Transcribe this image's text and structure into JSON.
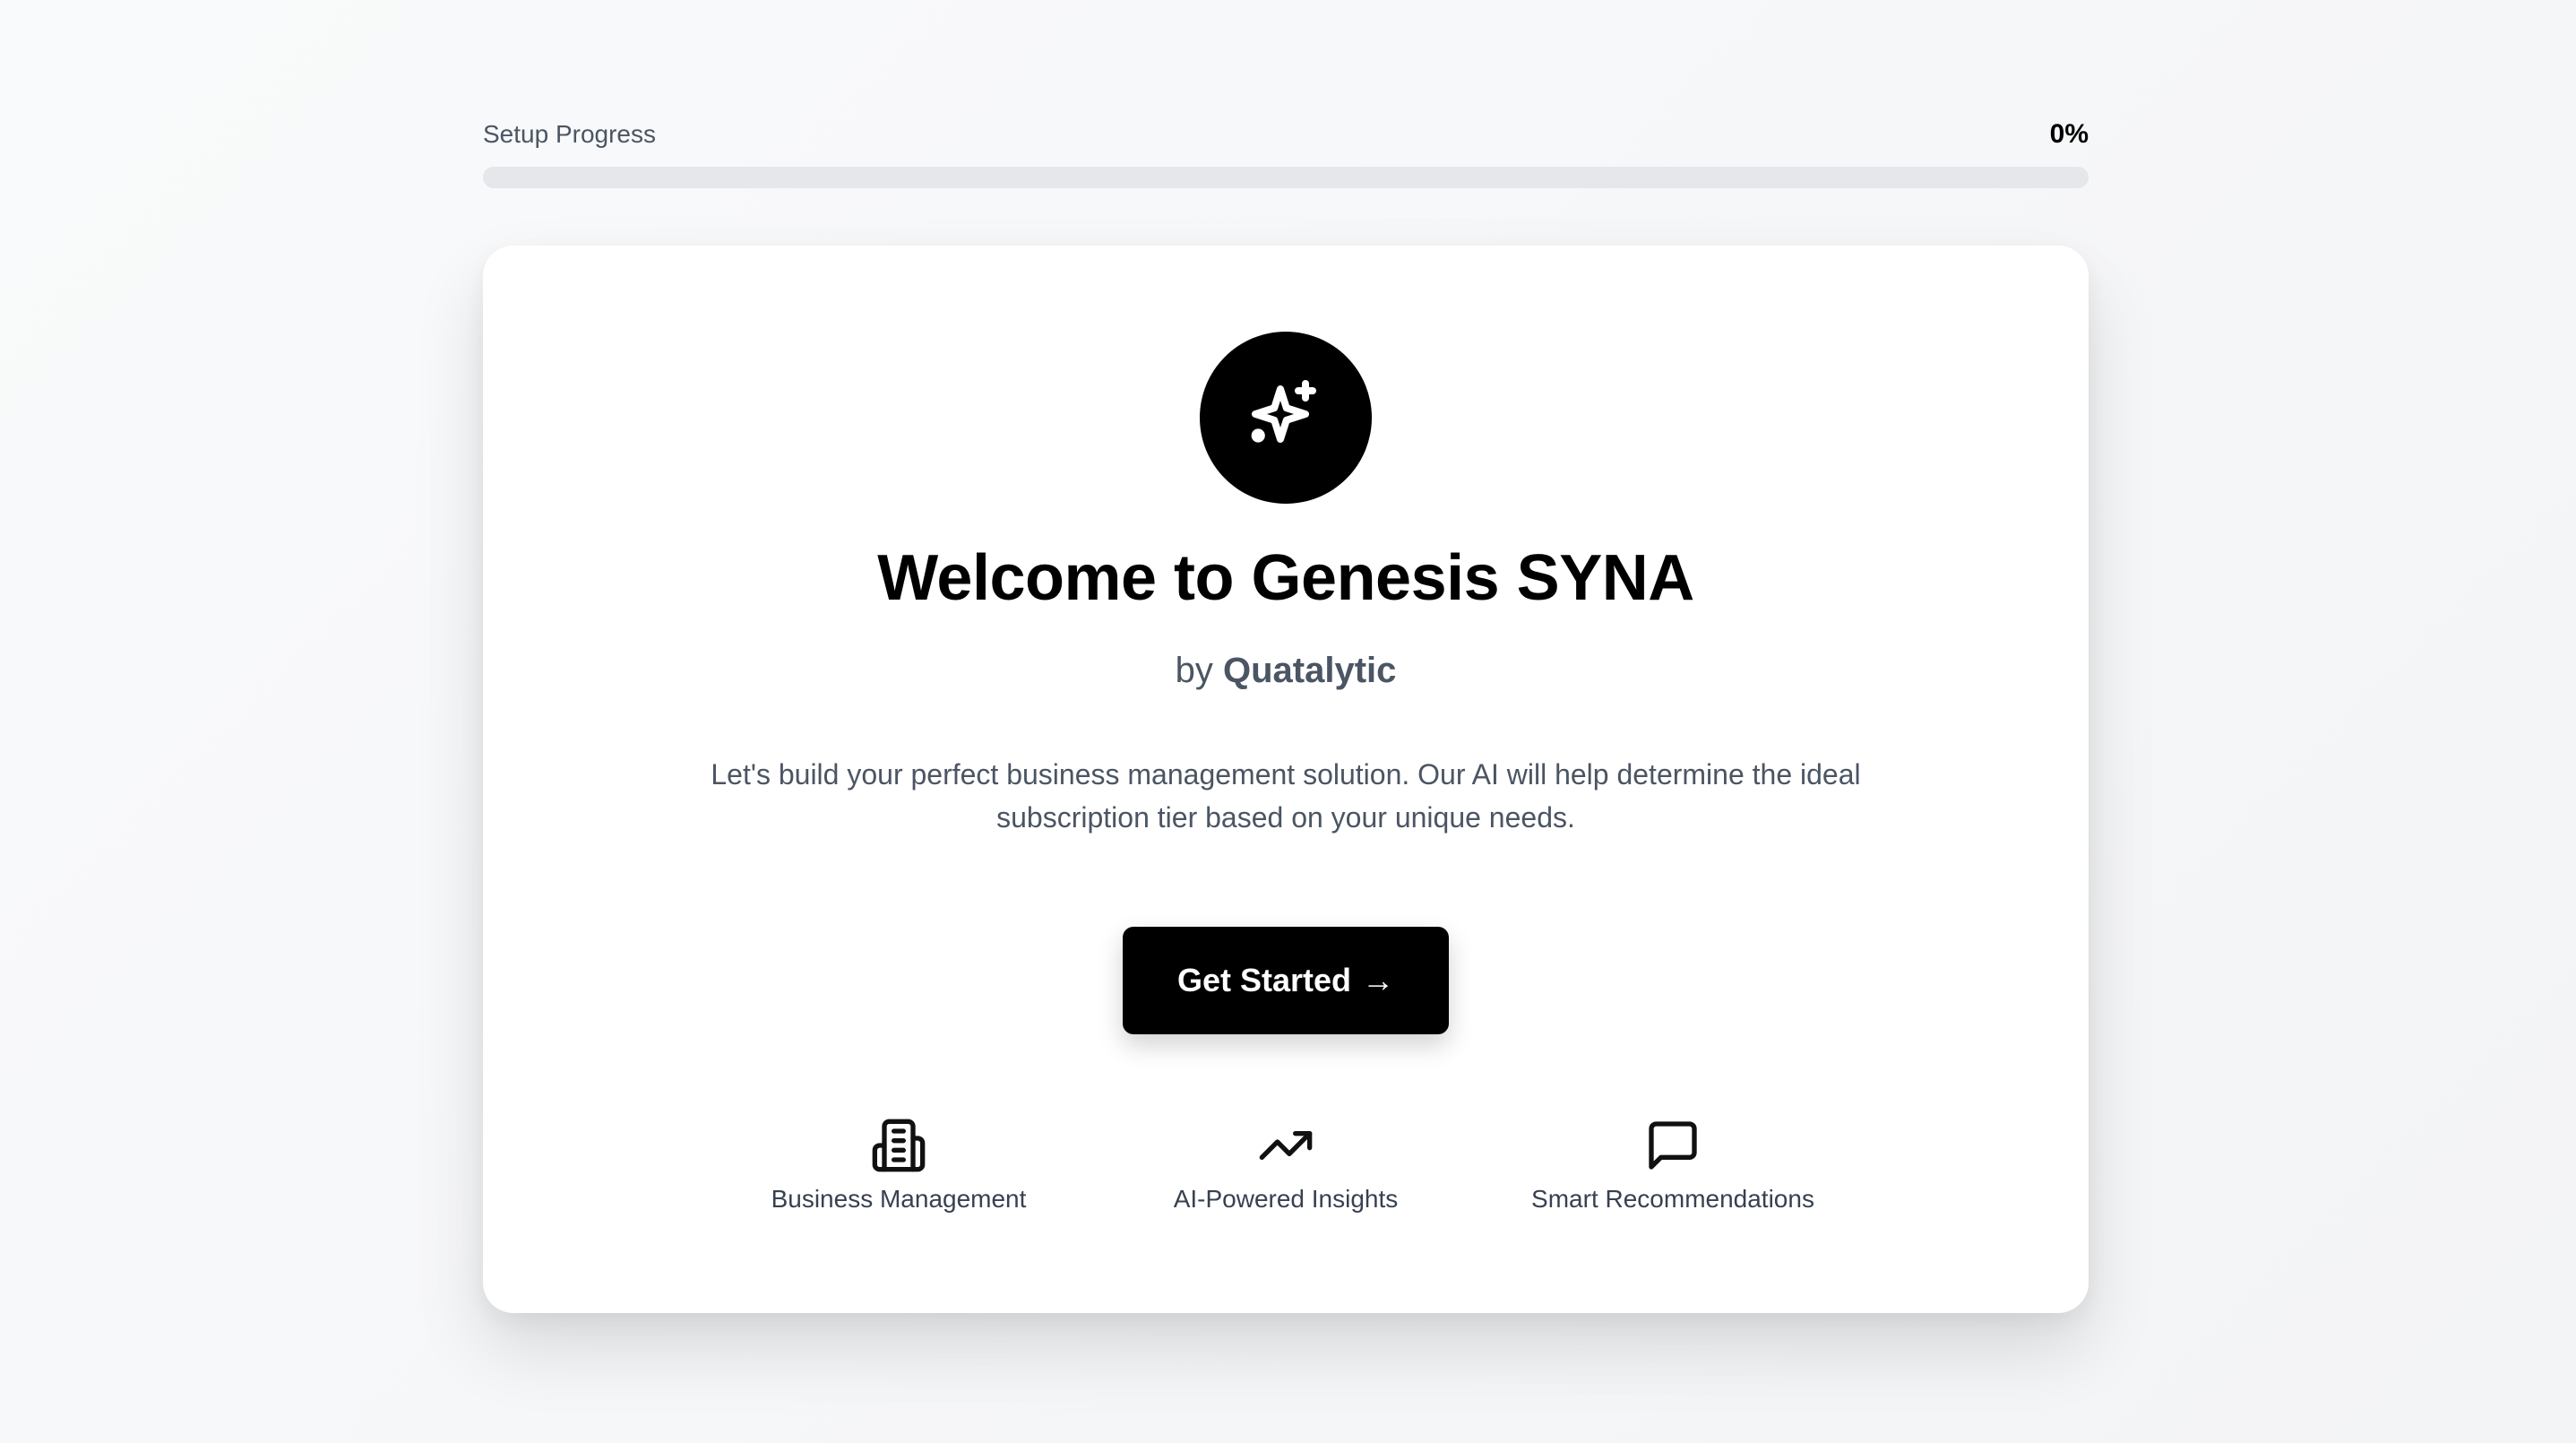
{
  "progress": {
    "label": "Setup Progress",
    "percent_text": "0%",
    "value": 0
  },
  "hero": {
    "icon": "sparkles-icon",
    "title": "Welcome to Genesis SYNA",
    "by_prefix": "by",
    "brand": "Quatalytic",
    "description": "Let's build your perfect business management solution. Our AI will help determine the ideal subscription tier based on your unique needs."
  },
  "cta": {
    "label": "Get Started",
    "arrow": "→"
  },
  "features": [
    {
      "icon": "building-icon",
      "label": "Business Management"
    },
    {
      "icon": "trending-up-icon",
      "label": "AI-Powered Insights"
    },
    {
      "icon": "message-square-icon",
      "label": "Smart Recommendations"
    }
  ],
  "colors": {
    "accent": "#000000",
    "text_muted": "#4b5563",
    "track": "#e5e7eb",
    "card": "#ffffff"
  }
}
